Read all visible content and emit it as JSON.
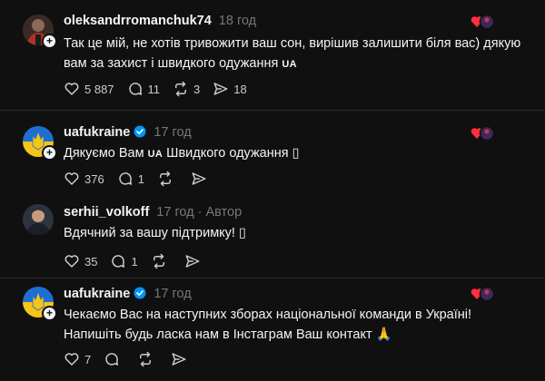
{
  "comments": [
    {
      "username": "oleksandrromanchuk74",
      "time": "18 год",
      "text_parts": [
        "Так це мій, не хотів тривожити ваш сон, вирішив залишити біля вас) дякую вам за захист і швидкого одужання ",
        "UA"
      ],
      "likes": "5 887",
      "replies": "11",
      "reposts": "3",
      "shares": "18"
    },
    {
      "username": "uafukraine",
      "time": "17 год",
      "text_parts": [
        "Дякуємо Вам ",
        "UA",
        " Швидкого одужання ",
        "▯"
      ],
      "likes": "376",
      "replies": "1"
    },
    {
      "username": "serhii_volkoff",
      "time": "17 год",
      "role": "Автор",
      "role_sep": "·",
      "text_parts": [
        "Вдячний за вашу підтримку! ",
        "▯"
      ],
      "likes": "35",
      "replies": "1"
    },
    {
      "username": "uafukraine",
      "time": "17 год",
      "text_parts": [
        "Чекаємо Вас на наступних зборах національної команди в Україні! Напишіть будь ласка нам в Інстаграм Ваш контакт ",
        "🙏"
      ],
      "likes": "7"
    }
  ],
  "icons": {
    "like": "heart-icon",
    "reply": "comment-icon",
    "repost": "repost-icon",
    "share": "send-icon",
    "verified": "verified-badge-icon",
    "follow": "plus-icon"
  },
  "colors": {
    "background": "#101010",
    "text": "#f3f5f7",
    "muted": "#777777",
    "verified": "#0095f6",
    "divider": "#2d2d2d"
  }
}
